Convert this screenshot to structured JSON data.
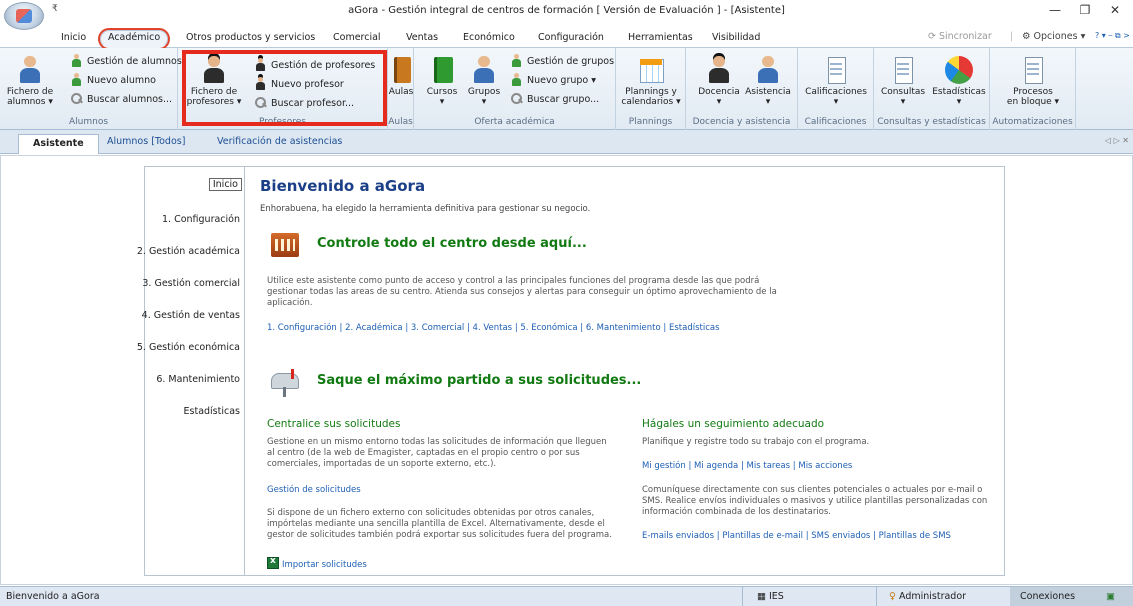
{
  "window": {
    "title": "aGora - Gestión integral de centros de formación [ Versión de Evaluación ] - [Asistente]",
    "qat_glyph": "₹",
    "minimize": "—",
    "maximize": "❐",
    "close": "✕"
  },
  "ribbon_tabs": [
    {
      "label": "Inicio"
    },
    {
      "label": "Académico"
    },
    {
      "label": "Otros productos y servicios"
    },
    {
      "label": "Comercial"
    },
    {
      "label": "Ventas"
    },
    {
      "label": "Económico"
    },
    {
      "label": "Configuración"
    },
    {
      "label": "Herramientas"
    },
    {
      "label": "Visibilidad"
    }
  ],
  "ribbon_right": {
    "sync": "Sincronizar",
    "options": "Opciones ▾",
    "sep": "|",
    "help": "? ▾  ⎯  ⧉  >"
  },
  "ribbon": {
    "alumnos": {
      "label": "Alumnos",
      "big": "Fichero de alumnos ▾",
      "big_l1": "Fichero de",
      "big_l2": "alumnos ▾",
      "s1": "Gestión de alumnos",
      "s2": "Nuevo alumno",
      "s3": "Buscar alumnos..."
    },
    "profesores": {
      "label": "Profesores",
      "big_l1": "Fichero de",
      "big_l2": "profesores ▾",
      "s1": "Gestión de profesores",
      "s2": "Nuevo profesor",
      "s3": "Buscar profesor..."
    },
    "aulas": {
      "label": "Aulas",
      "big": "Aulas"
    },
    "oferta": {
      "label": "Oferta académica",
      "cursos": "Cursos",
      "grupos": "Grupos",
      "caret": "▾",
      "s1": "Gestión de grupos",
      "s2": "Nuevo grupo ▾",
      "s3": "Buscar grupo..."
    },
    "plannings": {
      "label": "Plannings",
      "l1": "Plannings y",
      "l2": "calendarios ▾"
    },
    "docencia": {
      "label": "Docencia y asistencia",
      "b1": "Docencia",
      "b2": "Asistencia",
      "caret": "▾"
    },
    "calif": {
      "label": "Calificaciones",
      "b1": "Calificaciones",
      "caret": "▾"
    },
    "consultas": {
      "label": "Consultas y estadísticas",
      "b1": "Consultas",
      "b2": "Estadísticas",
      "caret": "▾"
    },
    "auto": {
      "label": "Automatizaciones",
      "l1": "Procesos",
      "l2": "en bloque ▾"
    }
  },
  "doc_tabs": [
    {
      "label": "Asistente"
    },
    {
      "label": "Alumnos [Todos]"
    },
    {
      "label": "Verificación de asistencias"
    }
  ],
  "doc_nav": "◁ ▷ ✕",
  "left_nav": [
    {
      "label": "Inicio"
    },
    {
      "label": "1. Configuración"
    },
    {
      "label": "2. Gestión académica"
    },
    {
      "label": "3. Gestión comercial"
    },
    {
      "label": "4. Gestión de ventas"
    },
    {
      "label": "5. Gestión económica"
    },
    {
      "label": "6. Mantenimiento"
    },
    {
      "label": "Estadísticas"
    }
  ],
  "content": {
    "title": "Bienvenido a aGora",
    "lead": "Enhorabuena, ha elegido la herramienta definitiva para gestionar su negocio.",
    "section1": {
      "heading": "Controle todo el centro desde aquí...",
      "para": "Utilice este asistente como punto de acceso y control a las principales funciones del programa desde las que podrá gestionar todas las areas de su centro. Atienda sus consejos y alertas para conseguir un óptimo aprovechamiento de la aplicación.",
      "links": [
        "1. Configuración",
        "2. Académica",
        "3. Comercial",
        "4. Ventas",
        "5. Económica",
        "6. Mantenimiento",
        "Estadísticas"
      ],
      "link_sep": "|"
    },
    "section2": {
      "heading": "Saque el máximo partido a sus solicitudes...",
      "left": {
        "title": "Centralice sus solicitudes",
        "para1": "Gestione en un mismo entorno todas las solicitudes de información que lleguen al centro (de la web de Emagister, captadas en el propio centro o por sus comerciales, importadas de un soporte externo, etc.).",
        "link1": "Gestión de solicitudes",
        "para2": "Si dispone de un fichero externo con solicitudes obtenidas por otros canales, impórtelas mediante una sencilla plantilla de Excel. Alternativamente, desde el gestor de solicitudes también podrá exportar sus solicitudes fuera del programa.",
        "import": "Importar solicitudes"
      },
      "right": {
        "title": "Hágales un seguimiento adecuado",
        "para1": "Planifique y registre todo su trabajo con el programa.",
        "links1": [
          "Mi gestión",
          "Mi agenda",
          "Mis tareas",
          "Mis acciones"
        ],
        "para2": "Comuníquese directamente con sus clientes potenciales o actuales por e-mail o SMS. Realice envíos individuales o masivos y utilice plantillas personalizadas con información combinada de los destinatarios.",
        "links2": [
          "E-mails enviados",
          "Plantillas de e-mail",
          "SMS enviados",
          "Plantillas de SMS"
        ]
      }
    }
  },
  "status": {
    "left": "Bienvenido a aGora",
    "org": "IES",
    "user": "Administrador",
    "conn": "Conexiones"
  },
  "colors": {
    "accent_blue": "#1b3f87",
    "heading_green": "#127a12",
    "link_blue": "#1d5fb4",
    "highlight_red": "#e52b1d"
  }
}
